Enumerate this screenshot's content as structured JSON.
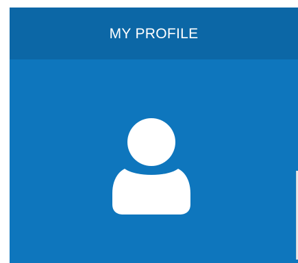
{
  "profile": {
    "title": "MY PROFILE",
    "avatar_icon": "user-icon"
  },
  "colors": {
    "header_bg": "#0c67a6",
    "body_bg": "#0e76bd",
    "icon": "#ffffff",
    "title_text": "#ffffff"
  }
}
